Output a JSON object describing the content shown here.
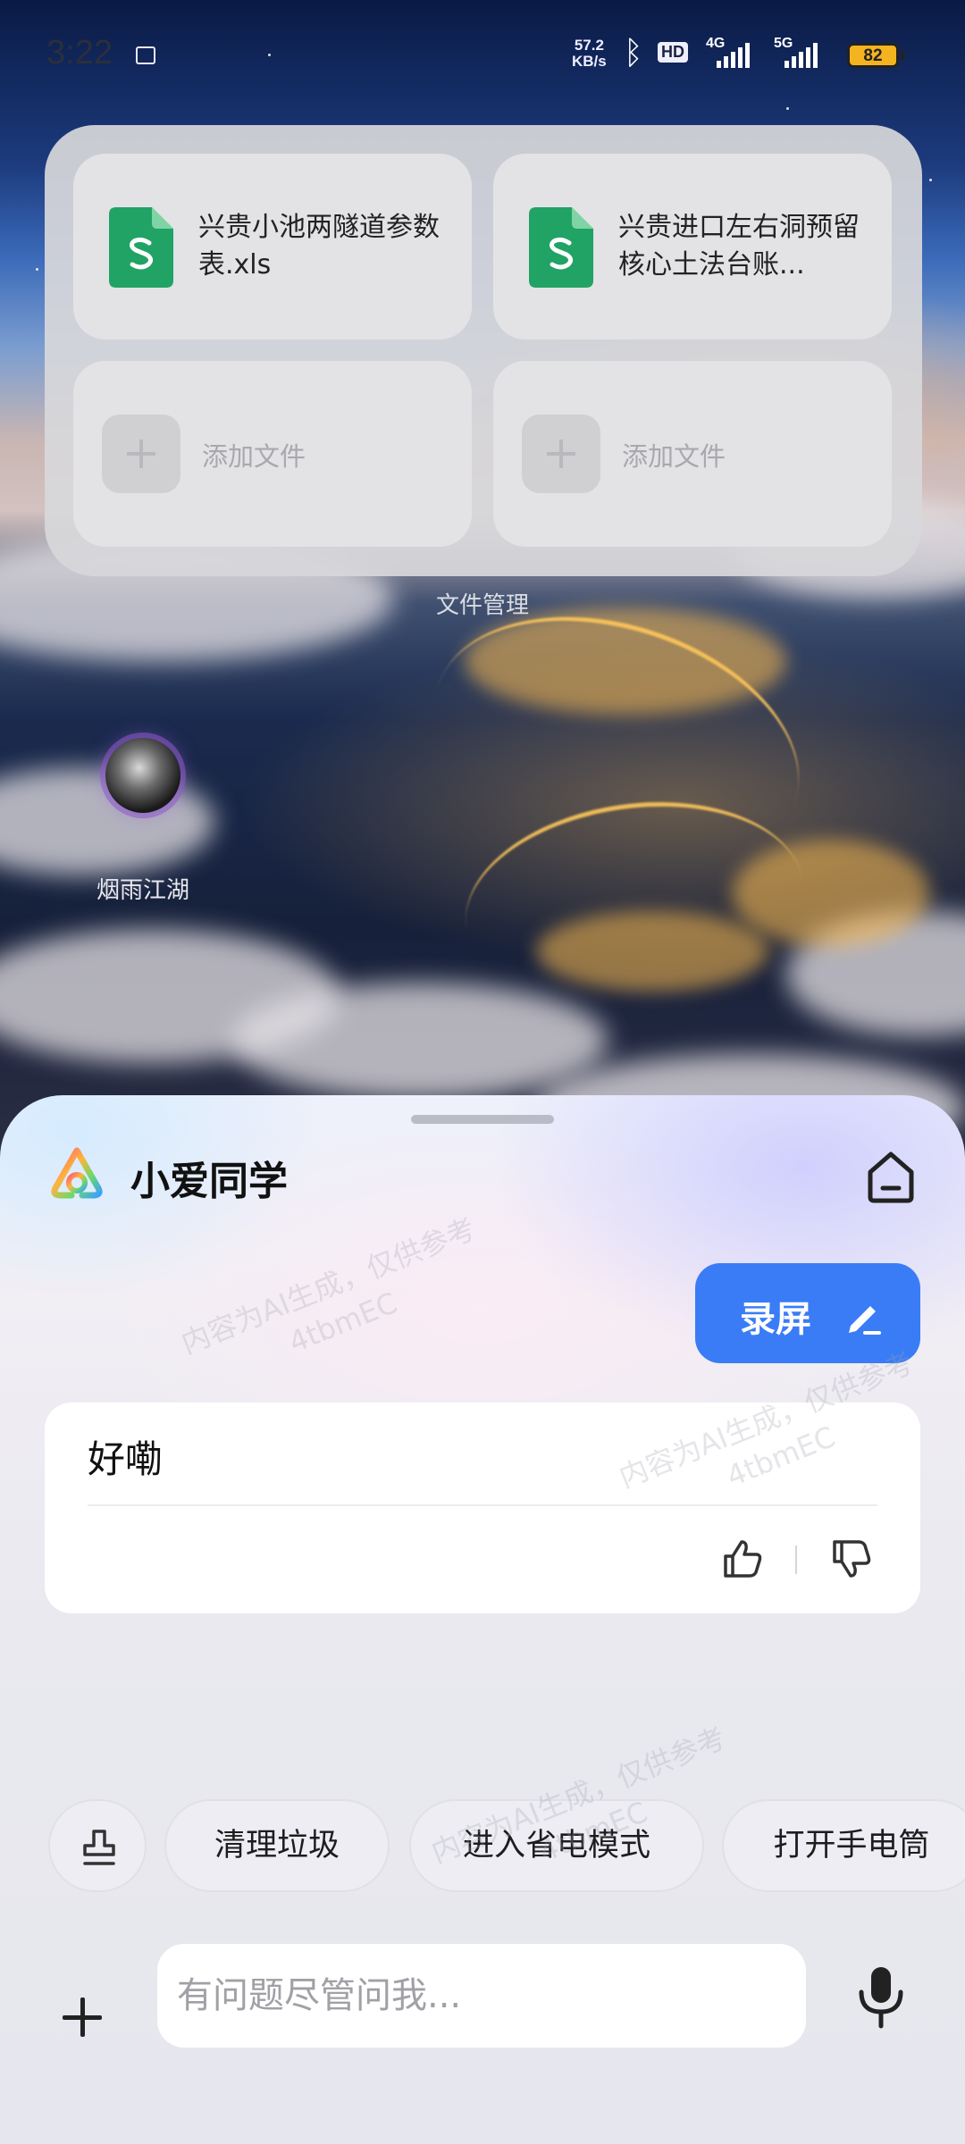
{
  "status_bar": {
    "time": "3:22",
    "net_speed_value": "57.2",
    "net_speed_unit": "KB/s",
    "hd_badge": "HD",
    "sim1_label": "4G",
    "sim2_label": "5G",
    "battery": "82",
    "battery_color": "#f4b420"
  },
  "file_widget": {
    "files": [
      {
        "name": "兴贵小池两隧道参数表.xls",
        "icon": "spreadsheet-icon"
      },
      {
        "name": "兴贵进口左右洞预留核心土法台账...",
        "icon": "spreadsheet-icon"
      }
    ],
    "add_slots": [
      {
        "label": "添加文件"
      },
      {
        "label": "添加文件"
      }
    ],
    "caption": "文件管理"
  },
  "contact": {
    "name": "烟雨江湖"
  },
  "assistant": {
    "name": "小爱同学",
    "record_button": "录屏",
    "reply": "好嘞",
    "quick_actions": [
      "清理垃圾",
      "进入省电模式",
      "打开手电筒"
    ],
    "input_placeholder": "有问题尽管问我...",
    "watermark_line1": "内容为AI生成，仅供参考",
    "watermark_line2": "4tbmEC",
    "accent_color": "#3a7cf6"
  }
}
